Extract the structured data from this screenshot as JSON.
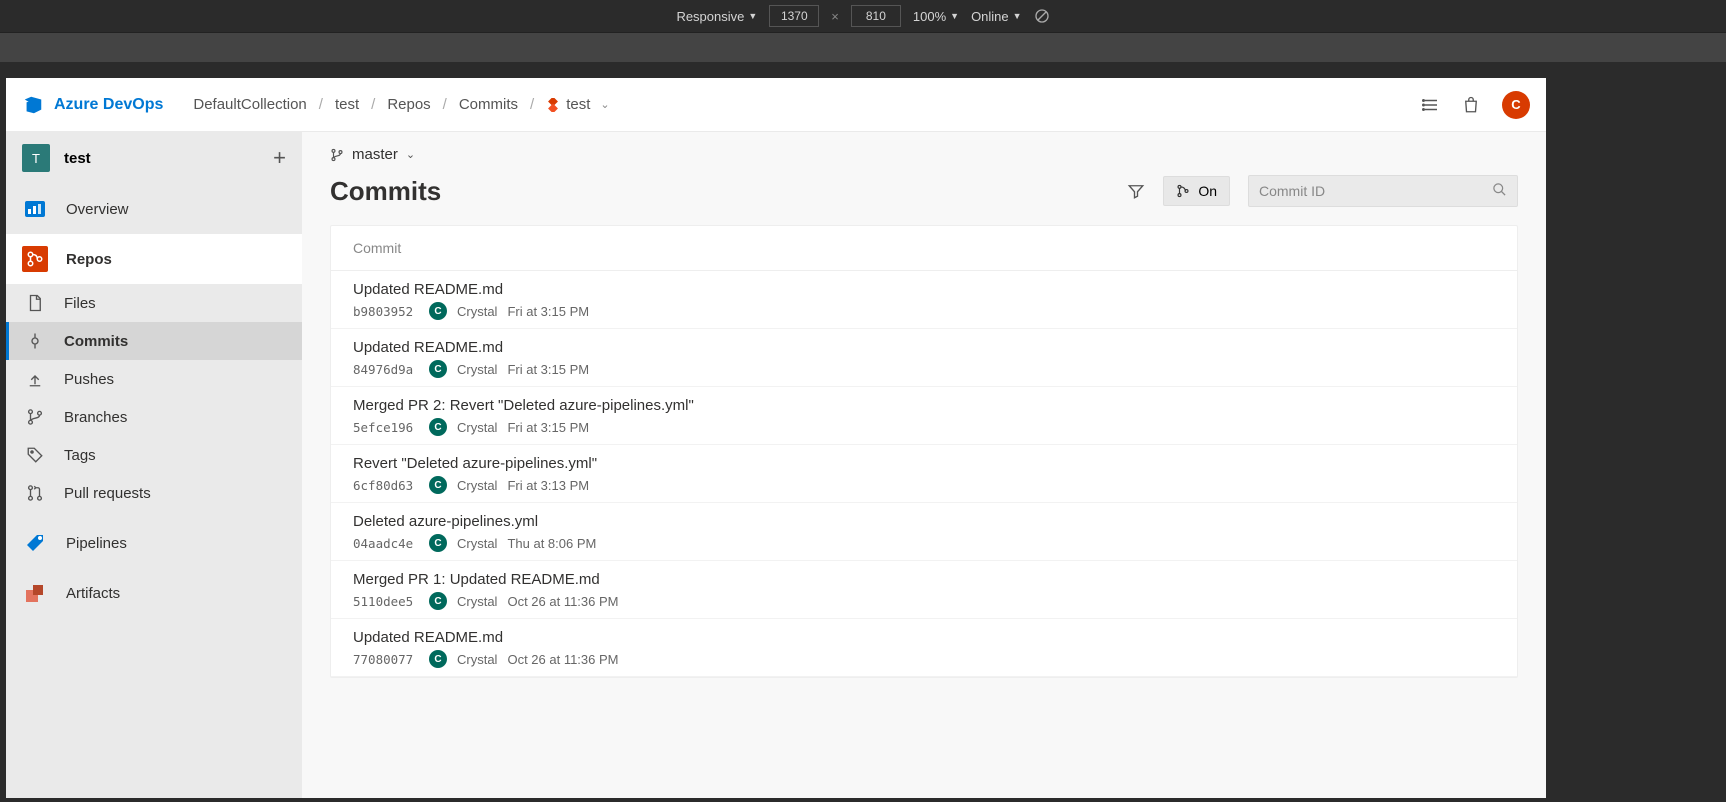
{
  "devtools": {
    "mode": "Responsive",
    "width": "1370",
    "height": "810",
    "zoom": "100%",
    "network": "Online"
  },
  "header": {
    "product": "Azure DevOps",
    "breadcrumb": [
      "DefaultCollection",
      "test",
      "Repos",
      "Commits"
    ],
    "repo_selector": "test",
    "avatar_letter": "C"
  },
  "sidebar": {
    "project_badge": "T",
    "project_name": "test",
    "nav": {
      "overview": "Overview",
      "repos": "Repos",
      "pipelines": "Pipelines",
      "artifacts": "Artifacts"
    },
    "repos_sub": {
      "files": "Files",
      "commits": "Commits",
      "pushes": "Pushes",
      "branches": "Branches",
      "tags": "Tags",
      "pull_requests": "Pull requests"
    }
  },
  "main": {
    "branch": "master",
    "title": "Commits",
    "graph_toggle": "On",
    "search_placeholder": "Commit ID",
    "column_header": "Commit",
    "author_default": "Crystal",
    "author_initial": "C",
    "commits": [
      {
        "title": "Updated README.md",
        "hash": "b9803952",
        "author": "Crystal",
        "time": "Fri at 3:15 PM"
      },
      {
        "title": "Updated README.md",
        "hash": "84976d9a",
        "author": "Crystal",
        "time": "Fri at 3:15 PM"
      },
      {
        "title": "Merged PR 2: Revert \"Deleted azure-pipelines.yml\"",
        "hash": "5efce196",
        "author": "Crystal",
        "time": "Fri at 3:15 PM"
      },
      {
        "title": "Revert \"Deleted azure-pipelines.yml\"",
        "hash": "6cf80d63",
        "author": "Crystal",
        "time": "Fri at 3:13 PM"
      },
      {
        "title": "Deleted azure-pipelines.yml",
        "hash": "04aadc4e",
        "author": "Crystal",
        "time": "Thu at 8:06 PM"
      },
      {
        "title": "Merged PR 1: Updated README.md",
        "hash": "5110dee5",
        "author": "Crystal",
        "time": "Oct 26 at 11:36 PM"
      },
      {
        "title": "Updated README.md",
        "hash": "77080077",
        "author": "Crystal",
        "time": "Oct 26 at 11:36 PM"
      }
    ]
  }
}
